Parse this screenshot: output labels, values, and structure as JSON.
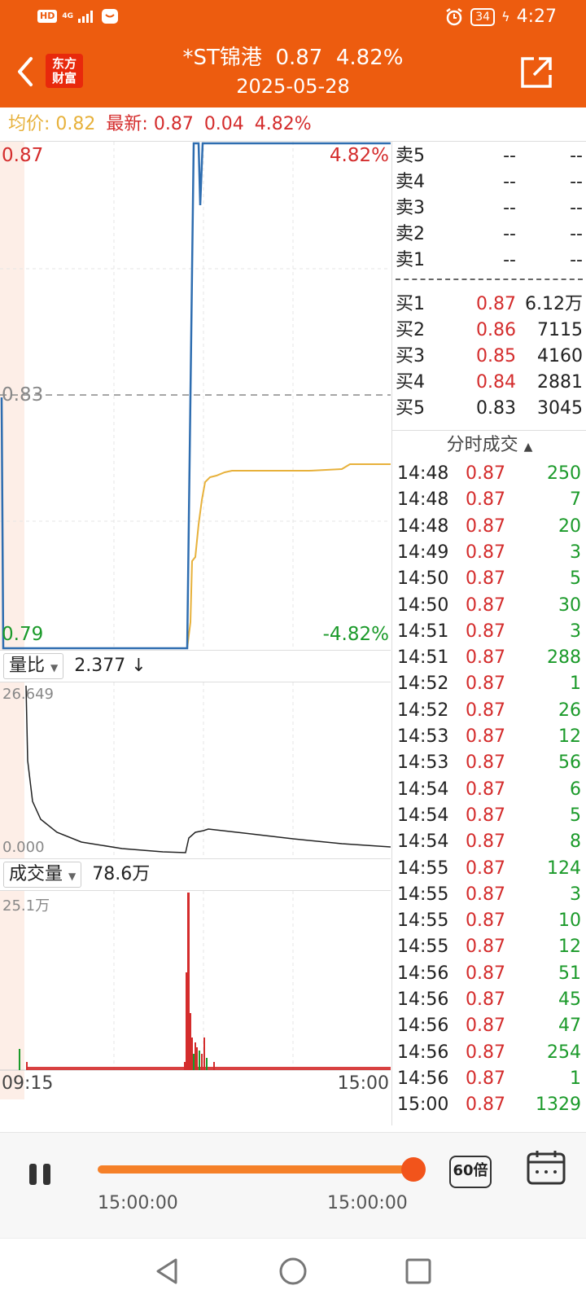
{
  "status": {
    "hd": "HD",
    "network": "4G",
    "battery": "34",
    "time": "4:27"
  },
  "header": {
    "logo_line1": "东方",
    "logo_line2": "财富",
    "title": "*ST锦港  0.87  4.82%",
    "date": "2025-05-28"
  },
  "quote": {
    "avg_label": "均价:",
    "avg_value": "0.82",
    "last_label": "最新:",
    "last_value": "0.87",
    "change": "0.04",
    "change_pct": "4.82%"
  },
  "price_chart": {
    "top_price": "0.87",
    "top_pct": "4.82%",
    "mid_price": "0.83",
    "bottom_price": "0.79",
    "bottom_pct": "-4.82%"
  },
  "indicator1": {
    "name": "量比",
    "value": "2.377",
    "arrow": "↓",
    "max": "26.649",
    "min": "0.000"
  },
  "indicator2": {
    "name": "成交量",
    "value": "78.6万",
    "max": "25.1万"
  },
  "time_axis": {
    "start": "09:15",
    "end": "15:00"
  },
  "orderbook": {
    "sells": [
      {
        "label": "卖5",
        "price": "--",
        "vol": "--"
      },
      {
        "label": "卖4",
        "price": "--",
        "vol": "--"
      },
      {
        "label": "卖3",
        "price": "--",
        "vol": "--"
      },
      {
        "label": "卖2",
        "price": "--",
        "vol": "--"
      },
      {
        "label": "卖1",
        "price": "--",
        "vol": "--"
      }
    ],
    "buys": [
      {
        "label": "买1",
        "price": "0.87",
        "vol": "6.12万"
      },
      {
        "label": "买2",
        "price": "0.86",
        "vol": "7115"
      },
      {
        "label": "买3",
        "price": "0.85",
        "vol": "4160"
      },
      {
        "label": "买4",
        "price": "0.84",
        "vol": "2881"
      },
      {
        "label": "买5",
        "price": "0.83",
        "vol": "3045"
      }
    ]
  },
  "trades_header": "分时成交",
  "trades": [
    {
      "time": "14:48",
      "price": "0.87",
      "vol": "250"
    },
    {
      "time": "14:48",
      "price": "0.87",
      "vol": "7"
    },
    {
      "time": "14:48",
      "price": "0.87",
      "vol": "20"
    },
    {
      "time": "14:49",
      "price": "0.87",
      "vol": "3"
    },
    {
      "time": "14:50",
      "price": "0.87",
      "vol": "5"
    },
    {
      "time": "14:50",
      "price": "0.87",
      "vol": "30"
    },
    {
      "time": "14:51",
      "price": "0.87",
      "vol": "3"
    },
    {
      "time": "14:51",
      "price": "0.87",
      "vol": "288"
    },
    {
      "time": "14:52",
      "price": "0.87",
      "vol": "1"
    },
    {
      "time": "14:52",
      "price": "0.87",
      "vol": "26"
    },
    {
      "time": "14:53",
      "price": "0.87",
      "vol": "12"
    },
    {
      "time": "14:53",
      "price": "0.87",
      "vol": "56"
    },
    {
      "time": "14:54",
      "price": "0.87",
      "vol": "6"
    },
    {
      "time": "14:54",
      "price": "0.87",
      "vol": "5"
    },
    {
      "time": "14:54",
      "price": "0.87",
      "vol": "8"
    },
    {
      "time": "14:55",
      "price": "0.87",
      "vol": "124"
    },
    {
      "time": "14:55",
      "price": "0.87",
      "vol": "3"
    },
    {
      "time": "14:55",
      "price": "0.87",
      "vol": "10"
    },
    {
      "time": "14:55",
      "price": "0.87",
      "vol": "12"
    },
    {
      "time": "14:56",
      "price": "0.87",
      "vol": "51"
    },
    {
      "time": "14:56",
      "price": "0.87",
      "vol": "45"
    },
    {
      "time": "14:56",
      "price": "0.87",
      "vol": "47"
    },
    {
      "time": "14:56",
      "price": "0.87",
      "vol": "254"
    },
    {
      "time": "14:56",
      "price": "0.87",
      "vol": "1"
    },
    {
      "time": "15:00",
      "price": "0.87",
      "vol": "1329"
    }
  ],
  "player": {
    "time_left": "15:00:00",
    "time_right": "15:00:00",
    "speed": "60倍",
    "progress": 1.0
  },
  "colors": {
    "brand": "#ed5c0f",
    "up": "#d42c2c",
    "down": "#1b9a2a",
    "price_line": "#2e6db0",
    "avg_line": "#e7b13b"
  }
}
